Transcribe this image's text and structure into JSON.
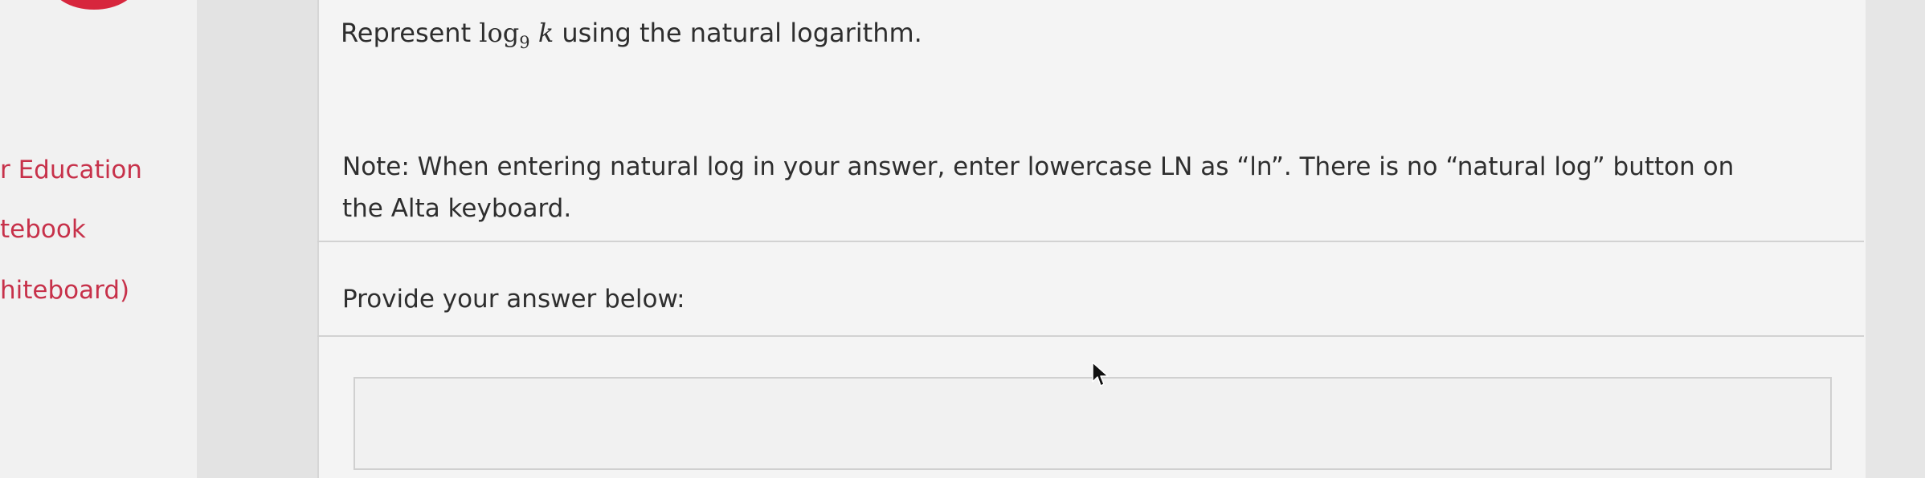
{
  "sidebar": {
    "items": [
      {
        "label": "r Education"
      },
      {
        "label": "tebook"
      },
      {
        "label": "hiteboard)"
      }
    ]
  },
  "question": {
    "prefix": "Represent ",
    "log_word": "log",
    "log_base": "9",
    "log_arg": "k",
    "suffix": " using the natural logarithm.",
    "note": "Note: When entering natural log in your answer, enter lowercase LN as “ln”. There is no “natural log” button on the Alta keyboard."
  },
  "answer": {
    "label": "Provide your answer below:",
    "value": ""
  }
}
